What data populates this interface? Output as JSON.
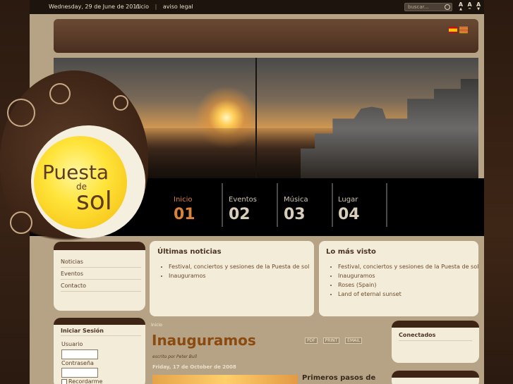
{
  "topbar": {
    "date": "Wednesday, 29 de June de 2011",
    "links": [
      "inicio",
      "aviso legal"
    ],
    "separator": "|",
    "search_placeholder": "buscar...",
    "font_sizes": [
      "A",
      "A",
      "A"
    ]
  },
  "logo": {
    "line1": "Puesta",
    "line2": "de",
    "line3": "sol"
  },
  "nav": [
    {
      "label": "Inicio",
      "number": "01",
      "active": true
    },
    {
      "label": "Eventos",
      "number": "02",
      "active": false
    },
    {
      "label": "Música",
      "number": "03",
      "active": false
    },
    {
      "label": "Lugar",
      "number": "04",
      "active": false
    }
  ],
  "menu": [
    "Noticias",
    "Eventos",
    "Contacto"
  ],
  "noticias": {
    "title": "Últimas noticias",
    "items": [
      "Festival, conciertos y sesiones de la Puesta de sol",
      "Inauguramos"
    ]
  },
  "mas_visto": {
    "title": "Lo más visto",
    "items": [
      "Festival, conciertos y sesiones de la Puesta de sol",
      "Inauguramos",
      "Roses (Spain)",
      "Land of eternal sunset"
    ]
  },
  "login": {
    "title": "Iniciar Sesión",
    "user_label": "Usuario",
    "pass_label": "Contraseña",
    "remember_label": "Recordarme"
  },
  "article": {
    "breadcrumb": "Inicio",
    "title": "Inauguramos",
    "author": "escrito por Peter Bull",
    "date": "Friday, 17 de October de 2008",
    "subtitle": "Primeros pasos de",
    "tools": [
      "PDF",
      "PRINT",
      "EMAIL"
    ]
  },
  "conectados": {
    "title": "Conectados"
  },
  "colors": {
    "accent": "#d9823a",
    "title": "#8a4a10",
    "panel": "#f3ecd9"
  }
}
